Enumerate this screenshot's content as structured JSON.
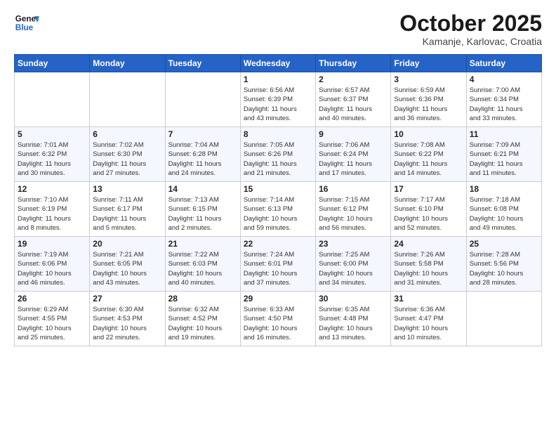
{
  "logo": {
    "line1": "General",
    "line2": "Blue"
  },
  "title": "October 2025",
  "location": "Kamanje, Karlovac, Croatia",
  "days_of_week": [
    "Sunday",
    "Monday",
    "Tuesday",
    "Wednesday",
    "Thursday",
    "Friday",
    "Saturday"
  ],
  "weeks": [
    [
      {
        "day": "",
        "info": ""
      },
      {
        "day": "",
        "info": ""
      },
      {
        "day": "",
        "info": ""
      },
      {
        "day": "1",
        "info": "Sunrise: 6:56 AM\nSunset: 6:39 PM\nDaylight: 11 hours\nand 43 minutes."
      },
      {
        "day": "2",
        "info": "Sunrise: 6:57 AM\nSunset: 6:37 PM\nDaylight: 11 hours\nand 40 minutes."
      },
      {
        "day": "3",
        "info": "Sunrise: 6:59 AM\nSunset: 6:36 PM\nDaylight: 11 hours\nand 36 minutes."
      },
      {
        "day": "4",
        "info": "Sunrise: 7:00 AM\nSunset: 6:34 PM\nDaylight: 11 hours\nand 33 minutes."
      }
    ],
    [
      {
        "day": "5",
        "info": "Sunrise: 7:01 AM\nSunset: 6:32 PM\nDaylight: 11 hours\nand 30 minutes."
      },
      {
        "day": "6",
        "info": "Sunrise: 7:02 AM\nSunset: 6:30 PM\nDaylight: 11 hours\nand 27 minutes."
      },
      {
        "day": "7",
        "info": "Sunrise: 7:04 AM\nSunset: 6:28 PM\nDaylight: 11 hours\nand 24 minutes."
      },
      {
        "day": "8",
        "info": "Sunrise: 7:05 AM\nSunset: 6:26 PM\nDaylight: 11 hours\nand 21 minutes."
      },
      {
        "day": "9",
        "info": "Sunrise: 7:06 AM\nSunset: 6:24 PM\nDaylight: 11 hours\nand 17 minutes."
      },
      {
        "day": "10",
        "info": "Sunrise: 7:08 AM\nSunset: 6:22 PM\nDaylight: 11 hours\nand 14 minutes."
      },
      {
        "day": "11",
        "info": "Sunrise: 7:09 AM\nSunset: 6:21 PM\nDaylight: 11 hours\nand 11 minutes."
      }
    ],
    [
      {
        "day": "12",
        "info": "Sunrise: 7:10 AM\nSunset: 6:19 PM\nDaylight: 11 hours\nand 8 minutes."
      },
      {
        "day": "13",
        "info": "Sunrise: 7:11 AM\nSunset: 6:17 PM\nDaylight: 11 hours\nand 5 minutes."
      },
      {
        "day": "14",
        "info": "Sunrise: 7:13 AM\nSunset: 6:15 PM\nDaylight: 11 hours\nand 2 minutes."
      },
      {
        "day": "15",
        "info": "Sunrise: 7:14 AM\nSunset: 6:13 PM\nDaylight: 10 hours\nand 59 minutes."
      },
      {
        "day": "16",
        "info": "Sunrise: 7:15 AM\nSunset: 6:12 PM\nDaylight: 10 hours\nand 56 minutes."
      },
      {
        "day": "17",
        "info": "Sunrise: 7:17 AM\nSunset: 6:10 PM\nDaylight: 10 hours\nand 52 minutes."
      },
      {
        "day": "18",
        "info": "Sunrise: 7:18 AM\nSunset: 6:08 PM\nDaylight: 10 hours\nand 49 minutes."
      }
    ],
    [
      {
        "day": "19",
        "info": "Sunrise: 7:19 AM\nSunset: 6:06 PM\nDaylight: 10 hours\nand 46 minutes."
      },
      {
        "day": "20",
        "info": "Sunrise: 7:21 AM\nSunset: 6:05 PM\nDaylight: 10 hours\nand 43 minutes."
      },
      {
        "day": "21",
        "info": "Sunrise: 7:22 AM\nSunset: 6:03 PM\nDaylight: 10 hours\nand 40 minutes."
      },
      {
        "day": "22",
        "info": "Sunrise: 7:24 AM\nSunset: 6:01 PM\nDaylight: 10 hours\nand 37 minutes."
      },
      {
        "day": "23",
        "info": "Sunrise: 7:25 AM\nSunset: 6:00 PM\nDaylight: 10 hours\nand 34 minutes."
      },
      {
        "day": "24",
        "info": "Sunrise: 7:26 AM\nSunset: 5:58 PM\nDaylight: 10 hours\nand 31 minutes."
      },
      {
        "day": "25",
        "info": "Sunrise: 7:28 AM\nSunset: 5:56 PM\nDaylight: 10 hours\nand 28 minutes."
      }
    ],
    [
      {
        "day": "26",
        "info": "Sunrise: 6:29 AM\nSunset: 4:55 PM\nDaylight: 10 hours\nand 25 minutes."
      },
      {
        "day": "27",
        "info": "Sunrise: 6:30 AM\nSunset: 4:53 PM\nDaylight: 10 hours\nand 22 minutes."
      },
      {
        "day": "28",
        "info": "Sunrise: 6:32 AM\nSunset: 4:52 PM\nDaylight: 10 hours\nand 19 minutes."
      },
      {
        "day": "29",
        "info": "Sunrise: 6:33 AM\nSunset: 4:50 PM\nDaylight: 10 hours\nand 16 minutes."
      },
      {
        "day": "30",
        "info": "Sunrise: 6:35 AM\nSunset: 4:48 PM\nDaylight: 10 hours\nand 13 minutes."
      },
      {
        "day": "31",
        "info": "Sunrise: 6:36 AM\nSunset: 4:47 PM\nDaylight: 10 hours\nand 10 minutes."
      },
      {
        "day": "",
        "info": ""
      }
    ]
  ]
}
